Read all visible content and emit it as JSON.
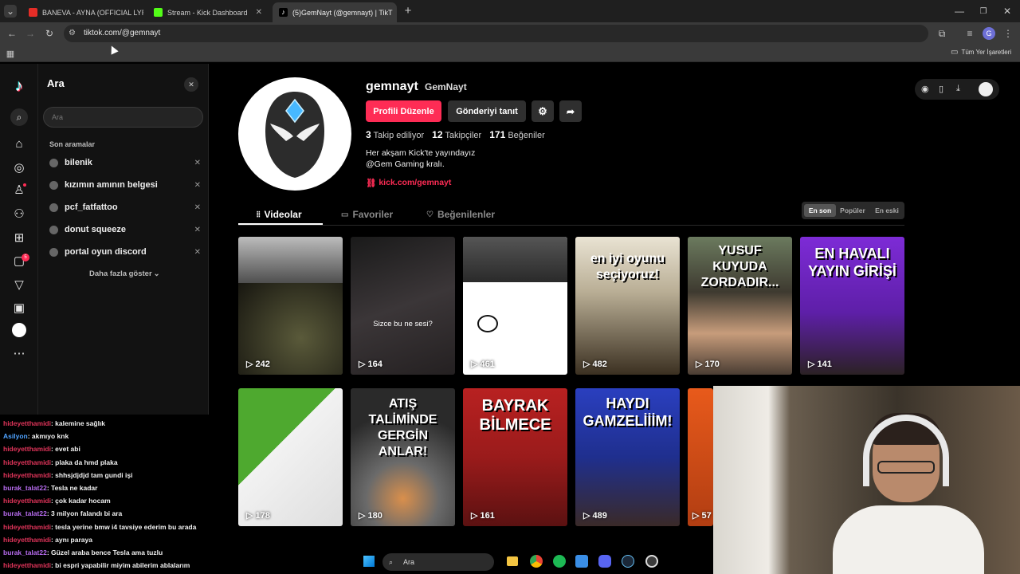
{
  "browser": {
    "tabs": [
      {
        "title": "BANEVA - AYNA (OFFICIAL LYRIC",
        "favicon_color": "#e52d27"
      },
      {
        "title": "Stream - Kick Dashboard",
        "favicon_color": "#53fc18"
      },
      {
        "title": "(5)GemNayt (@gemnayt) | TikT",
        "favicon_color": "#ffffff"
      }
    ],
    "new_tab_glyph": "+",
    "url": "tiktok.com/@gemnayt",
    "bookmarks_label": "Tüm Yer İşaretleri"
  },
  "search": {
    "title": "Ara",
    "placeholder": "Ara",
    "recent_heading": "Son aramalar",
    "recent": [
      "bilenik",
      "kızımın amının belgesi",
      "pcf_fatfattoo",
      "donut squeeze",
      "portal oyun discord"
    ],
    "show_more": "Daha fazla göster"
  },
  "rail": {
    "badges": {
      "messages": "5"
    }
  },
  "profile": {
    "username": "gemnayt",
    "display_name": "GemNayt",
    "edit_button": "Profili Düzenle",
    "promote_button": "Gönderiyi tanıt",
    "stats": [
      {
        "value": "3",
        "label": "Takip ediliyor"
      },
      {
        "value": "12",
        "label": "Takipçiler"
      },
      {
        "value": "171",
        "label": "Beğeniler"
      }
    ],
    "bio_line1": "Her akşam Kick'te yayındayız",
    "bio_line2": "@Gem Gaming kralı.",
    "link": "kick.com/gemnayt"
  },
  "content_tabs": {
    "videos": "Videolar",
    "favorites": "Favoriler",
    "liked": "Beğenilenler"
  },
  "sort": {
    "latest": "En son",
    "popular": "Popüler",
    "oldest": "En eski"
  },
  "videos_row1": [
    {
      "views": "242",
      "title": ""
    },
    {
      "views": "164",
      "title": "Sizce bu ne sesi?"
    },
    {
      "views": "461",
      "title": ""
    },
    {
      "views": "482",
      "title": "en iyi oyunu seçiyoruz!"
    },
    {
      "views": "170",
      "title": "YUSUF KUYUDA ZORDADIR..."
    },
    {
      "views": "141",
      "title": "EN HAVALI YAYIN GİRİŞİ"
    }
  ],
  "videos_row2": [
    {
      "views": "178",
      "title": ""
    },
    {
      "views": "180",
      "title": "ATIŞ TALİMİNDE GERGİN ANLAR!"
    },
    {
      "views": "161",
      "title": "BAYRAK BİLMECE"
    },
    {
      "views": "489",
      "title": "HAYDI GAMZELİİİM!"
    },
    {
      "views": "57",
      "title": ""
    }
  ],
  "chat": [
    {
      "user": "hideyetthamidi",
      "color": "#e0345a",
      "msg": ": kalemine sağlık"
    },
    {
      "user": "Asilyon",
      "color": "#4fa3ff",
      "msg": ": akmıyo knk"
    },
    {
      "user": "hideyetthamidi",
      "color": "#e0345a",
      "msg": ": evet abi"
    },
    {
      "user": "hideyetthamidi",
      "color": "#e0345a",
      "msg": ": plaka da hmd plaka"
    },
    {
      "user": "hideyetthamidi",
      "color": "#e0345a",
      "msg": ": shhsjdjdjd tam gundi işi"
    },
    {
      "user": "burak_talat22",
      "color": "#b86cf0",
      "msg": ": Tesla ne kadar"
    },
    {
      "user": "hideyetthamidi",
      "color": "#e0345a",
      "msg": ": çok kadar hocam"
    },
    {
      "user": "burak_talat22",
      "color": "#b86cf0",
      "msg": ": 3 milyon falandı bi ara"
    },
    {
      "user": "hideyetthamidi",
      "color": "#e0345a",
      "msg": ": tesla yerine bmw i4 tavsiye ederim bu arada"
    },
    {
      "user": "hideyetthamidi",
      "color": "#e0345a",
      "msg": ": aynı paraya"
    },
    {
      "user": "burak_talat22",
      "color": "#b86cf0",
      "msg": ": Güzel araba bence Tesla ama tuzlu"
    },
    {
      "user": "hideyetthamidi",
      "color": "#e0345a",
      "msg": ": bi espri yapabilir miyim abilerim ablalarım"
    }
  ],
  "taskbar": {
    "search": "Ara"
  },
  "colors": {
    "accent": "#fe2c55",
    "link": "#fe2c55"
  }
}
